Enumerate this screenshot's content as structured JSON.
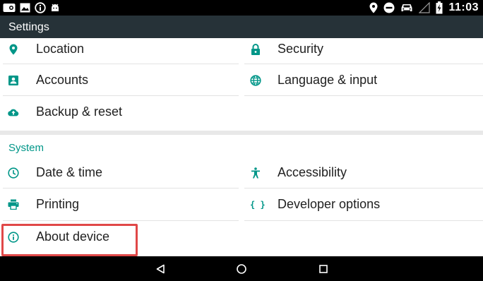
{
  "status_bar": {
    "time": "11:03",
    "left_icons": [
      "voicemail-icon",
      "image-icon",
      "info-icon",
      "android-icon"
    ],
    "right_icons": [
      "location-icon",
      "do-not-disturb-icon",
      "car-icon",
      "signal-icon",
      "battery-charging-icon"
    ]
  },
  "action_bar": {
    "title": "Settings",
    "background": "#263238"
  },
  "colors": {
    "accent": "#009688",
    "highlight": "#e04848"
  },
  "personal": {
    "items": [
      {
        "label": "Location",
        "icon": "location-icon"
      },
      {
        "label": "Security",
        "icon": "lock-icon"
      },
      {
        "label": "Accounts",
        "icon": "account-icon"
      },
      {
        "label": "Language & input",
        "icon": "globe-icon"
      },
      {
        "label": "Backup & reset",
        "icon": "cloud-upload-icon"
      }
    ]
  },
  "system": {
    "header": "System",
    "items": [
      {
        "label": "Date & time",
        "icon": "clock-icon"
      },
      {
        "label": "Accessibility",
        "icon": "accessibility-icon"
      },
      {
        "label": "Printing",
        "icon": "printer-icon"
      },
      {
        "label": "Developer options",
        "icon": "braces-icon"
      },
      {
        "label": "About device",
        "icon": "info-icon"
      }
    ]
  },
  "nav_bar": {
    "buttons": [
      "back-icon",
      "home-icon",
      "recents-icon"
    ]
  }
}
